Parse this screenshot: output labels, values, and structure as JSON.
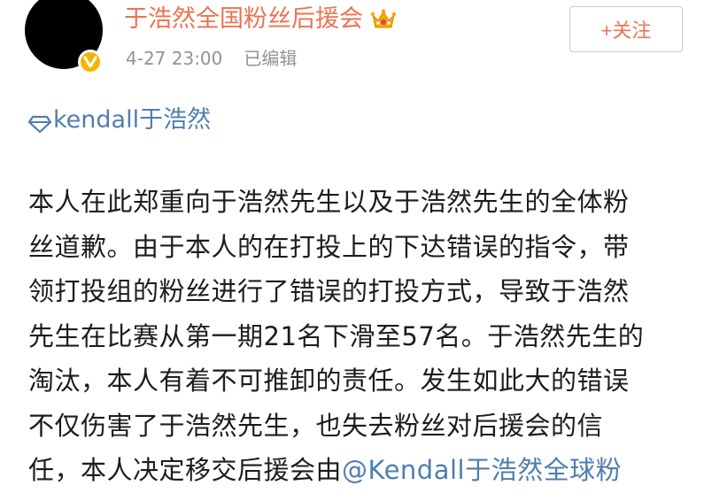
{
  "post": {
    "author": {
      "name": "于浩然全国粉丝后援会",
      "avatar_icon": "avatar",
      "verified_icon": "verified-badge-icon",
      "crown_icon": "crown-icon"
    },
    "timestamp": "4-27 23:00",
    "edited_label": "已编辑",
    "follow_label": "+关注",
    "topic": {
      "icon": "diamond-icon",
      "label": "kendall于浩然"
    },
    "body_lines": [
      "本人在此郑重向于浩然先生以及于浩然先生的全体粉",
      "丝道歉。由于本人的在打投上的下达错误的指令，带",
      "领打投组的粉丝进行了错误的打投方式，导致于浩然",
      "先生在比赛从第一期21名下滑至57名。于浩然先生的",
      "淘汰，本人有着不可推卸的责任。发生如此大的错误",
      "不仅伤害了于浩然先生，也失去粉丝对后援会的信"
    ],
    "last_line": {
      "text": "任，本人决定移交后援会由",
      "mention": "@Kendall于浩然全球粉"
    },
    "colors": {
      "name": "#eb7350",
      "link": "#507daf",
      "meta": "#939393",
      "badge": "#f5b400"
    }
  }
}
